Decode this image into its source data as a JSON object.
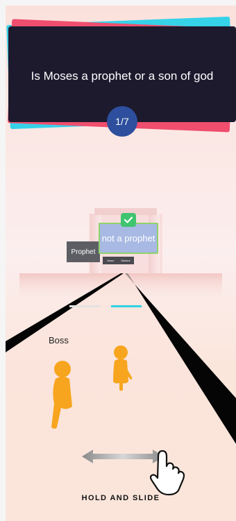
{
  "question": {
    "text": "Is Moses a prophet or a son of god",
    "progress": "1/7"
  },
  "answers": {
    "selected_label": "not a prophet",
    "other_label": "Prophet",
    "mini_left": "Jesus",
    "mini_right": "Saviour"
  },
  "characters": {
    "boss_label": "Boss"
  },
  "instruction": "HOLD AND SLIDE",
  "colors": {
    "card": "#1d1a2e",
    "card_accent_blue": "#35d2e8",
    "card_accent_red": "#ef4e6e",
    "progress_badge": "#2d4f9d",
    "check": "#3fc46f",
    "runner": "#f7a51e"
  }
}
